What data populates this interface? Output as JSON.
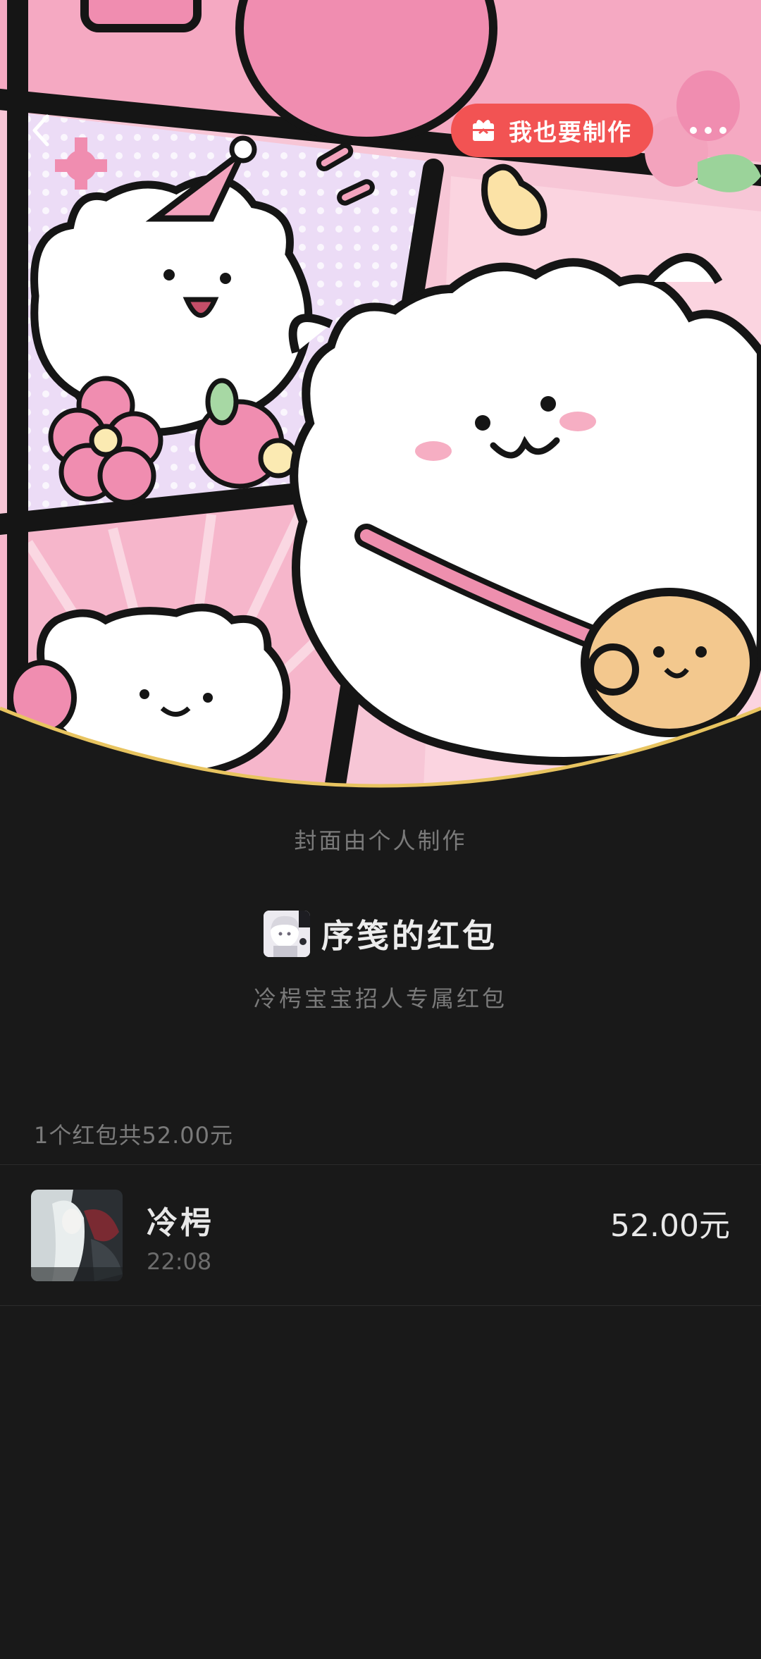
{
  "header": {
    "make_button_label": "我也要制作",
    "back_icon": "back-arrow-icon",
    "more_icon": "more-dots-icon",
    "gift_icon": "gift-icon"
  },
  "cover": {
    "credit": "封面由个人制作"
  },
  "envelope": {
    "sender_name": "序笺的红包",
    "blessing": "冷枵宝宝招人专属红包"
  },
  "summary": "1个红包共52.00元",
  "receivers": [
    {
      "name": "冷枵",
      "time": "22:08",
      "amount": "52.00元"
    }
  ],
  "colors": {
    "background": "#191919",
    "accent": "#f25353",
    "cover_border": "#e8c460"
  }
}
